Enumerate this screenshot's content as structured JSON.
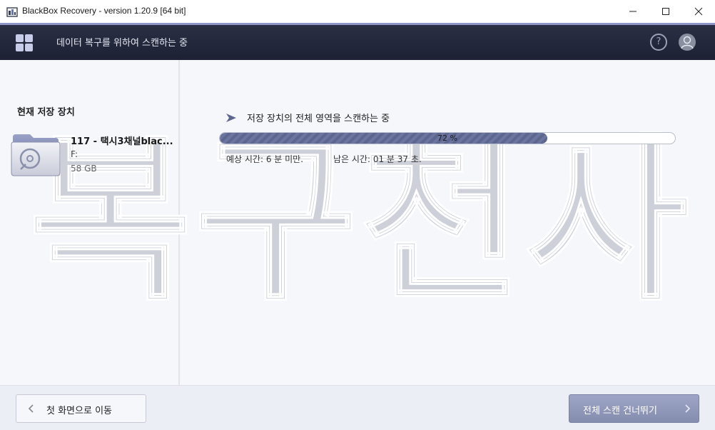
{
  "window": {
    "title": "BlackBox Recovery - version 1.20.9 [64 bit]"
  },
  "header": {
    "title": "데이터 복구를 위하여 스캔하는 중",
    "help_symbol": "?"
  },
  "left_panel": {
    "section_label": "현재 저장 장치",
    "drive": {
      "name": "117 - 택시3채널blac...",
      "letter": "F:",
      "size": "58 GB"
    }
  },
  "scan": {
    "title": "저장 장치의 전체 영역을 스캔하는 중",
    "progress_percent": 72,
    "progress_label": "72 %",
    "estimated_time": "예상 시간:  6 분 미만.",
    "remaining_time": "남은 시간:  01 분  37 초."
  },
  "watermark": "복구천사",
  "footer": {
    "back_label": "첫 화면으로 이동",
    "skip_label": "전체 스캔 건너뛰기"
  },
  "colors": {
    "header_bg": "#1d2133",
    "accent": "#8e96c9",
    "progress_fill": "#5d668f",
    "skip_button": "#858daf"
  },
  "icons": [
    "app-icon",
    "minimize-icon",
    "maximize-icon",
    "close-icon",
    "grid-menu-icon",
    "help-icon",
    "user-avatar-icon",
    "drive-folder-icon",
    "play-arrow-icon",
    "chevron-left-icon",
    "chevron-right-icon"
  ]
}
